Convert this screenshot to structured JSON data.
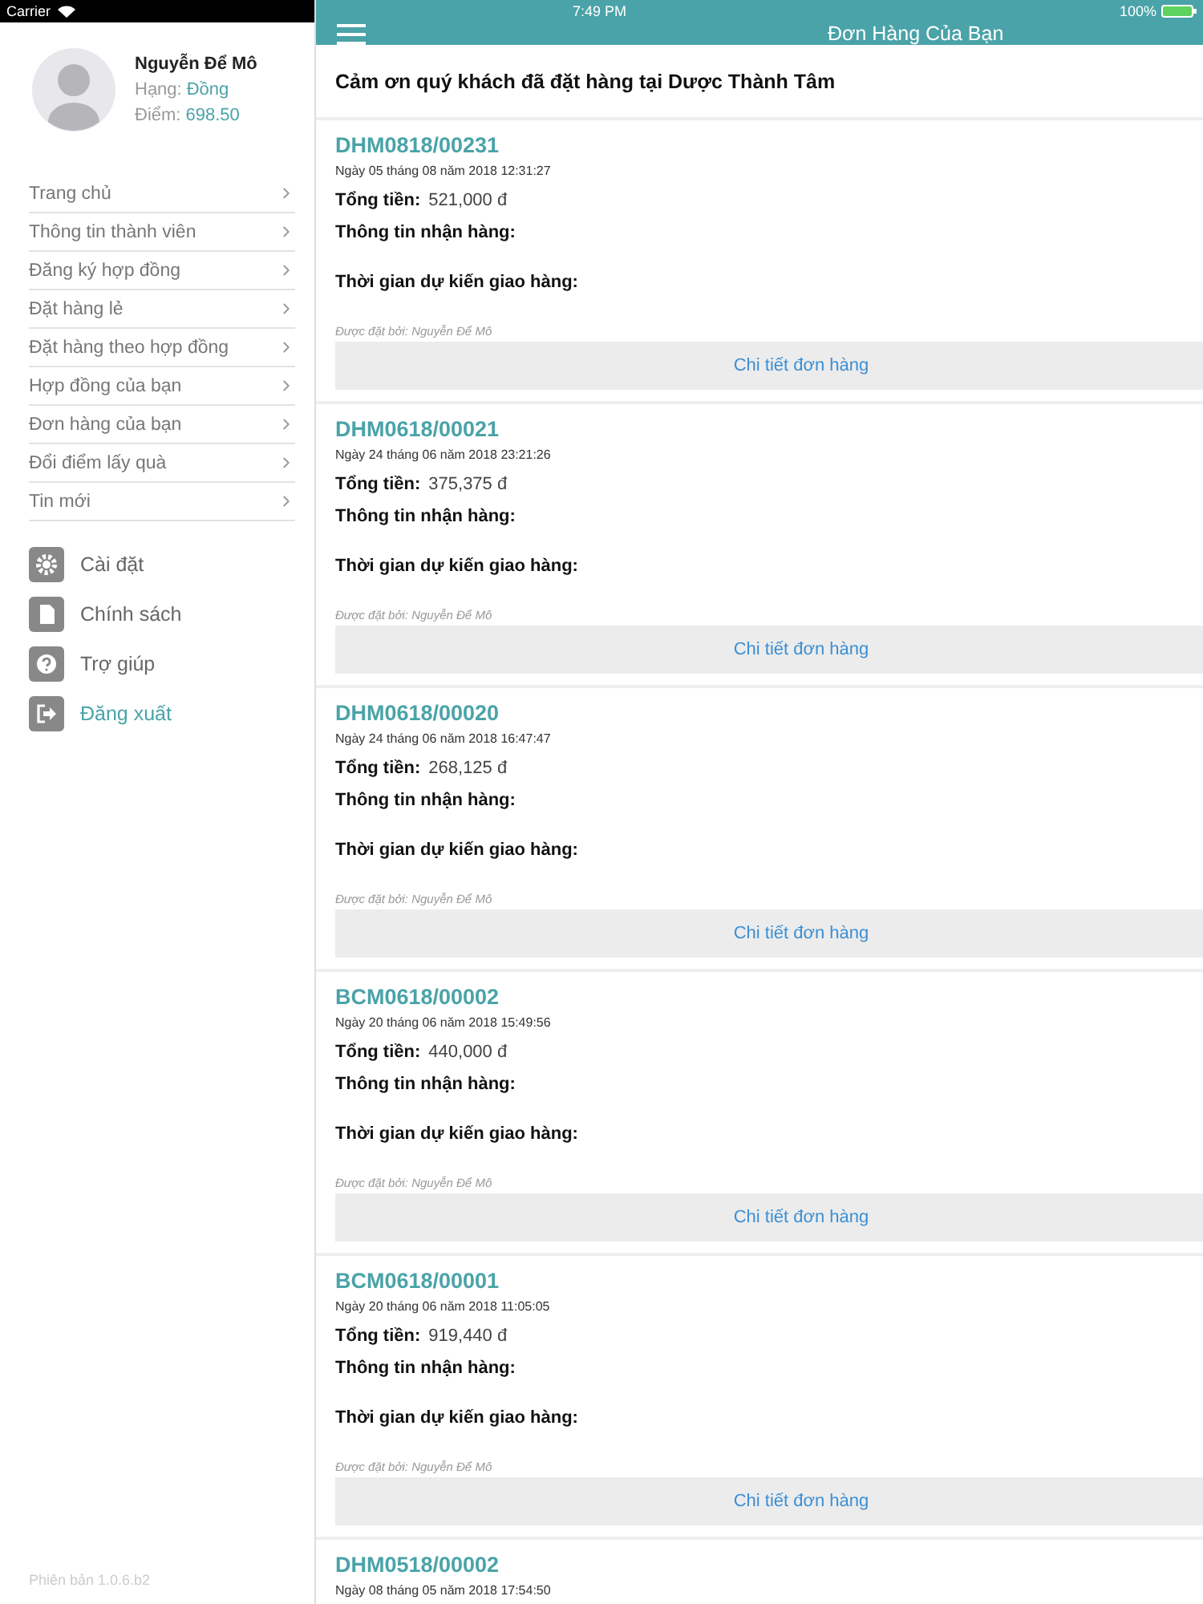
{
  "status_bar": {
    "carrier": "Carrier",
    "time": "7:49 PM",
    "battery": "100%"
  },
  "profile": {
    "name": "Nguyễn Để Mô",
    "rank_label": "Hạng:",
    "rank": "Đồng",
    "points_label": "Điểm:",
    "points": "698.50"
  },
  "menu": [
    "Trang chủ",
    "Thông tin thành viên",
    "Đăng ký hợp đồng",
    "Đặt hàng lẻ",
    "Đặt hàng theo hợp đồng",
    "Hợp đồng của bạn",
    "Đơn hàng của bạn",
    "Đổi điểm lấy quà",
    "Tin mới"
  ],
  "actions": [
    {
      "label": "Cài đặt",
      "kind": "gear",
      "accent": false
    },
    {
      "label": "Chính sách",
      "kind": "document",
      "accent": false
    },
    {
      "label": "Trợ giúp",
      "kind": "help",
      "accent": false
    },
    {
      "label": "Đăng xuất",
      "kind": "logout",
      "accent": true
    }
  ],
  "version": "Phiên bản 1.0.6.b2",
  "header": {
    "title": "Đơn Hàng Của Bạn"
  },
  "thanks": "Cảm ơn quý khách đã đặt hàng tại Dược Thành Tâm",
  "orders": [
    {
      "code": "DHM0818/00231",
      "date": "Ngày 05 tháng 08 năm 2018 12:31:27",
      "total_label": "Tổng tiền:",
      "total": "521,000 đ",
      "receive_label": "Thông tin nhận hàng:",
      "delivery_label": "Thời gian dự kiến giao hàng:",
      "ordered_by": "Được đặt bởi: Nguyễn Để Mô",
      "button": "Chi tiết đơn hàng"
    },
    {
      "code": "DHM0618/00021",
      "date": "Ngày 24 tháng 06 năm 2018 23:21:26",
      "total_label": "Tổng tiền:",
      "total": "375,375 đ",
      "receive_label": "Thông tin nhận hàng:",
      "delivery_label": "Thời gian dự kiến giao hàng:",
      "ordered_by": "Được đặt bởi: Nguyễn Để Mô",
      "button": "Chi tiết đơn hàng"
    },
    {
      "code": "DHM0618/00020",
      "date": "Ngày 24 tháng 06 năm 2018 16:47:47",
      "total_label": "Tổng tiền:",
      "total": "268,125 đ",
      "receive_label": "Thông tin nhận hàng:",
      "delivery_label": "Thời gian dự kiến giao hàng:",
      "ordered_by": "Được đặt bởi: Nguyễn Để Mô",
      "button": "Chi tiết đơn hàng"
    },
    {
      "code": "BCM0618/00002",
      "date": "Ngày 20 tháng 06 năm 2018 15:49:56",
      "total_label": "Tổng tiền:",
      "total": "440,000 đ",
      "receive_label": "Thông tin nhận hàng:",
      "delivery_label": "Thời gian dự kiến giao hàng:",
      "ordered_by": "Được đặt bởi: Nguyễn Để Mô",
      "button": "Chi tiết đơn hàng"
    },
    {
      "code": "BCM0618/00001",
      "date": "Ngày 20 tháng 06 năm 2018 11:05:05",
      "total_label": "Tổng tiền:",
      "total": "919,440 đ",
      "receive_label": "Thông tin nhận hàng:",
      "delivery_label": "Thời gian dự kiến giao hàng:",
      "ordered_by": "Được đặt bởi: Nguyễn Để Mô",
      "button": "Chi tiết đơn hàng"
    },
    {
      "code": "DHM0518/00002",
      "date": "Ngày 08 tháng 05 năm 2018 17:54:50"
    }
  ]
}
